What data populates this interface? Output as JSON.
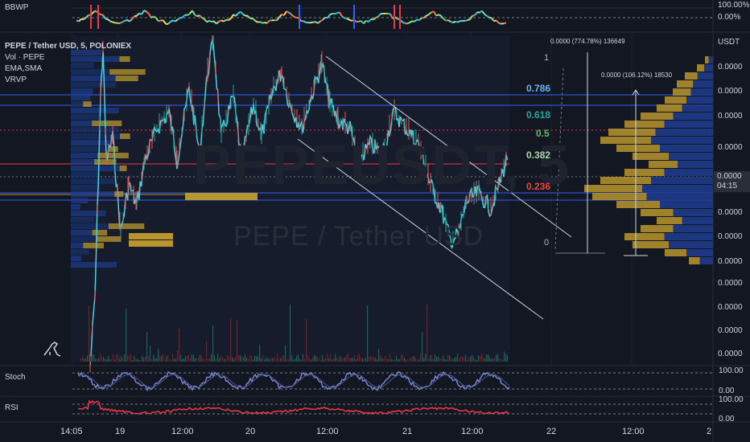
{
  "symbol_title": "PEPE / Tether USD, 5, POLONIEX",
  "watermark_symbol": "PEPEUSDT, 5",
  "watermark_name": "PEPE / Tether USD",
  "indicators": [
    "Vol · PEPE",
    "EMA,SMA",
    "VRVP"
  ],
  "panes": {
    "bbwp": {
      "title": "BBWP",
      "ticks": [
        "100.00%",
        "0.00%"
      ]
    },
    "stoch": {
      "title": "Stoch",
      "ticks": [
        "100.00",
        "0.00"
      ]
    },
    "rsi": {
      "title": "RSI",
      "ticks": [
        "100.00",
        "0.00"
      ]
    }
  },
  "price_axis": {
    "currency": "USDT",
    "labels": [
      "0.0000",
      "0.0000",
      "0.0000",
      "0.0000",
      "0.0000",
      "0.0000",
      "0.0000",
      "0.0000",
      "0.0000",
      "0.0000",
      "0.0000",
      "0.0000"
    ],
    "current_price": "0.0000",
    "countdown": "04:15"
  },
  "time_axis": [
    "14:05",
    "19",
    "12:00",
    "20",
    "12:00",
    "21",
    "12:00",
    "22",
    "12:00",
    "2"
  ],
  "fib_levels": [
    {
      "label": "1",
      "value": 1,
      "color": "#b2b5be"
    },
    {
      "label": "0.786",
      "value": 0.786,
      "color": "#64b5f6"
    },
    {
      "label": "0.618",
      "value": 0.618,
      "color": "#26a69a"
    },
    {
      "label": "0.5",
      "value": 0.5,
      "color": "#66bb6a"
    },
    {
      "label": "0.382",
      "value": 0.382,
      "color": "#a5d6a7"
    },
    {
      "label": "0.236",
      "value": 0.236,
      "color": "#f44336"
    },
    {
      "label": "0",
      "value": 0,
      "color": "#b2b5be"
    }
  ],
  "measure_labels": [
    "0.0000 (774.78%) 136649",
    "0.0000 (106.12%) 18530"
  ],
  "colors": {
    "background": "#131722",
    "price_line": "#4dd0e1",
    "candle_up": "#26a69a",
    "candle_down": "#ef5350",
    "vp_up": "#b8952d",
    "vp_down": "#1e3a8a",
    "stoch_line": "#7986cb",
    "rsi_line": "#f23645",
    "horizontal_blue": "#2962ff",
    "horizontal_red": "#f23645"
  },
  "chart_data": {
    "type": "line",
    "title": "PEPE / Tether USD, 5, POLONIEX",
    "xlabel": "",
    "ylabel": "USDT",
    "x": [
      "14:05",
      "19",
      "12:00",
      "20",
      "12:00",
      "21",
      "12:00",
      "22",
      "12:00",
      "2"
    ],
    "series": [],
    "grid": true,
    "legend": "top-left"
  }
}
